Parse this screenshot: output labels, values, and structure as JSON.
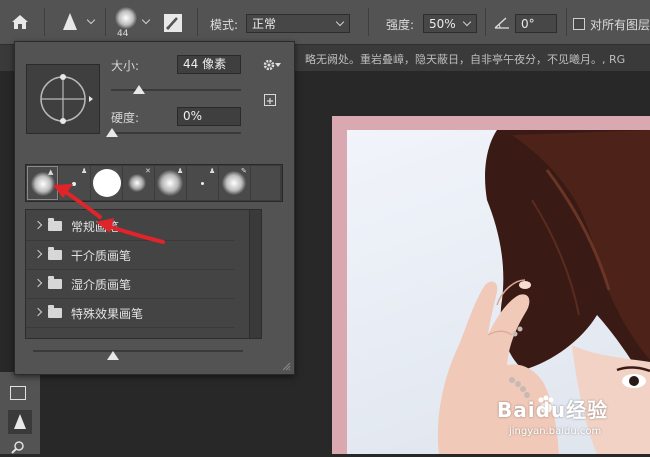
{
  "options_bar": {
    "brush_size_label": "44",
    "mode_label": "模式:",
    "mode_value": "正常",
    "strength_label": "强度:",
    "strength_value": "50%",
    "angle_value": "0°",
    "sample_all_label": "对所有图层"
  },
  "document": {
    "tab_text": "略无阙处。重岩叠嶂，隐天蔽日，自非亭午夜分，不见曦月。, RG"
  },
  "brush_panel": {
    "size_label": "大小:",
    "size_value": "44 像素",
    "hardness_label": "硬度:",
    "hardness_value": "0%",
    "folders": [
      {
        "label": "常规画笔"
      },
      {
        "label": "干介质画笔"
      },
      {
        "label": "湿介质画笔"
      },
      {
        "label": "特殊效果画笔"
      }
    ]
  },
  "watermark": {
    "brand": "Baidu经验",
    "url": "jingyan.baidu.com"
  },
  "colors": {
    "annotation_arrow": "#e0242a",
    "panel_bg": "#535353",
    "canvas_bg": "#282828",
    "frame": "#d9a8b0"
  }
}
